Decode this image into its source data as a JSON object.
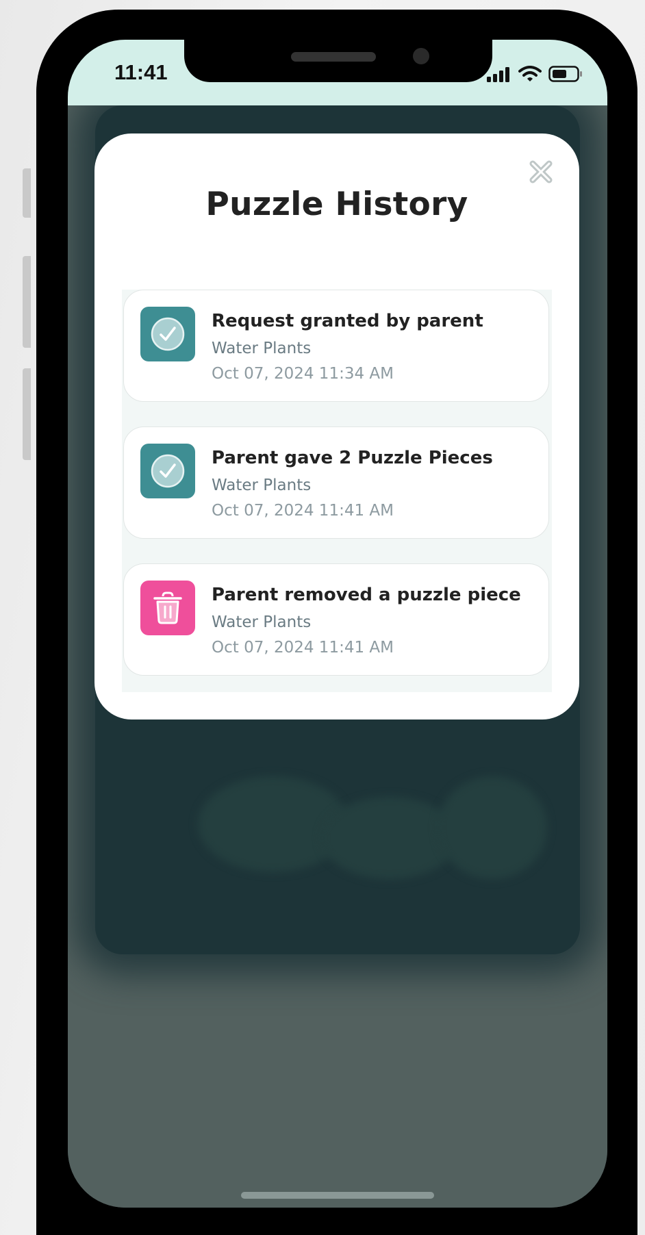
{
  "status_bar": {
    "time": "11:41"
  },
  "modal": {
    "title": "Puzzle History",
    "close_icon": "close-icon",
    "items": [
      {
        "title": "Request granted by parent",
        "subtitle": "Water Plants",
        "timestamp": "Oct 07, 2024 11:34 AM",
        "icon": "check-circle-icon",
        "icon_color": "#3e8e93"
      },
      {
        "title": "Parent gave 2 Puzzle Pieces",
        "subtitle": "Water Plants",
        "timestamp": "Oct 07, 2024 11:41 AM",
        "icon": "check-circle-icon",
        "icon_color": "#3e8e93"
      },
      {
        "title": "Parent removed a puzzle piece",
        "subtitle": "Water Plants",
        "timestamp": "Oct 07, 2024 11:41 AM",
        "icon": "trash-icon",
        "icon_color": "#ef4f9b"
      }
    ]
  },
  "colors": {
    "status_bar_bg": "#d3efe9",
    "overlay_bg": "#53615f",
    "accent_teal": "#3e8e93",
    "accent_pink": "#ef4f9b"
  }
}
